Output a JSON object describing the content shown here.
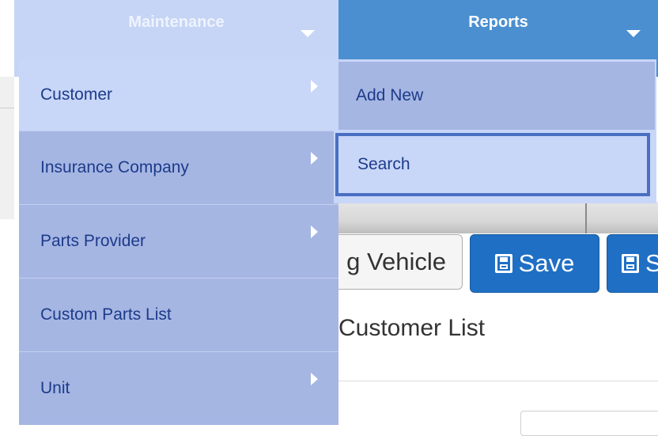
{
  "nav": {
    "maintenance_label": "Maintenance",
    "reports_label": "Reports"
  },
  "menu": {
    "items": [
      {
        "label": "Customer",
        "has_submenu": true
      },
      {
        "label": "Insurance Company",
        "has_submenu": true
      },
      {
        "label": "Parts Provider",
        "has_submenu": true
      },
      {
        "label": "Custom Parts List",
        "has_submenu": false
      },
      {
        "label": "Unit",
        "has_submenu": true
      }
    ]
  },
  "submenu": {
    "items": [
      {
        "label": "Add New"
      },
      {
        "label": "Search"
      }
    ]
  },
  "page": {
    "missing_vehicle_label": "g Vehicle",
    "save_label": "Save",
    "save2_label": "S",
    "customer_list_label": "Customer List"
  },
  "colors": {
    "nav_blue": "#4b8fd0",
    "menu_bg": "#a6b6e3",
    "menu_active": "#c8d6f8",
    "menu_text": "#1c3b8a",
    "save_button": "#1f6fc5",
    "focus_outline": "#4a6fc2"
  }
}
